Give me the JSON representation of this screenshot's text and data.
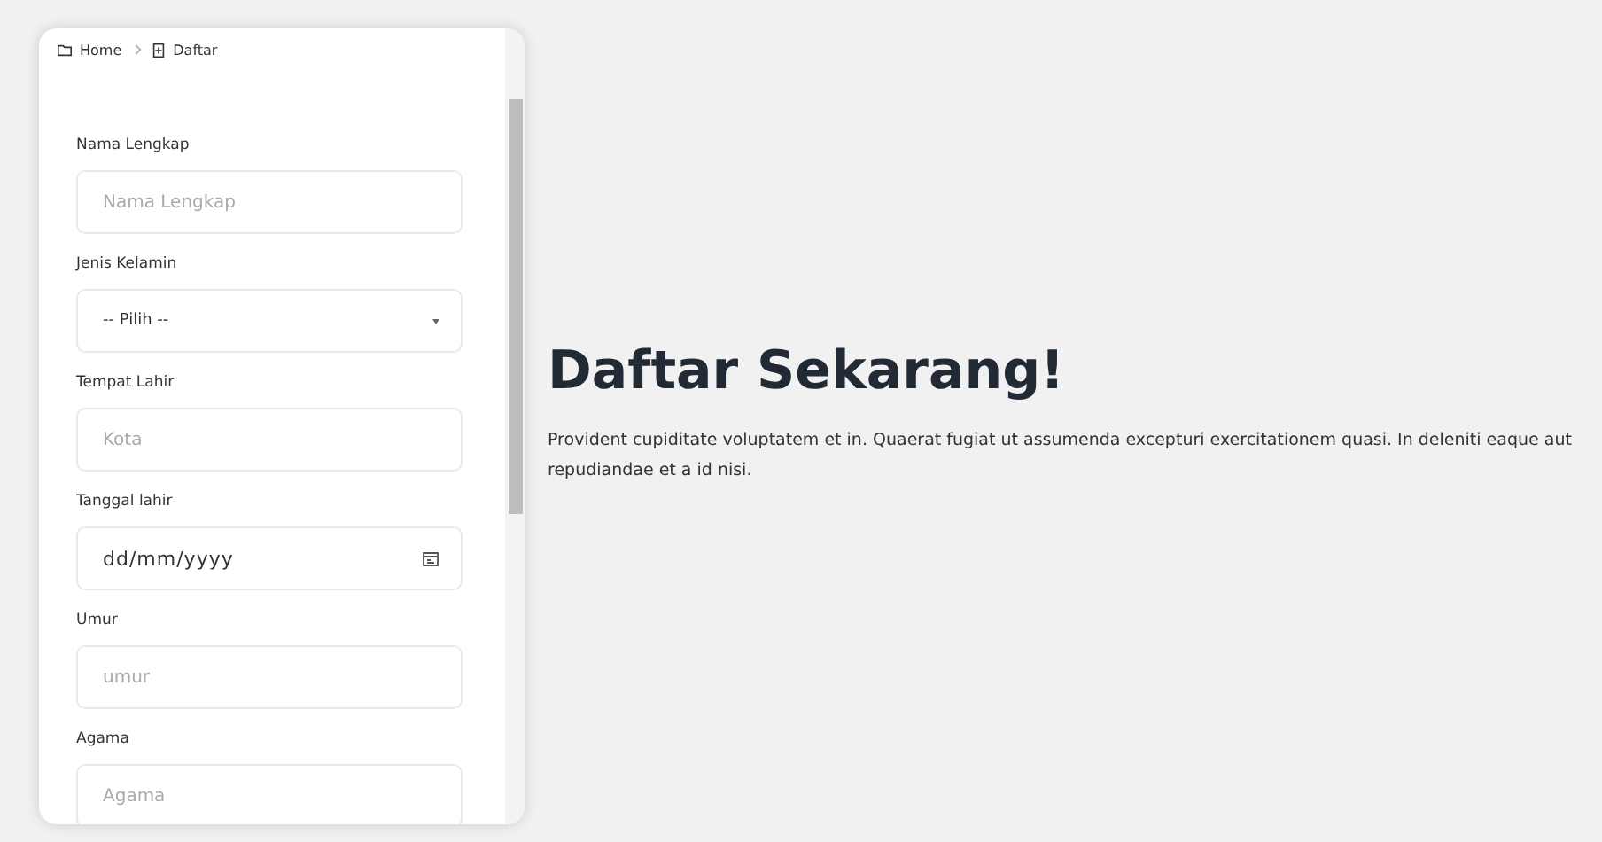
{
  "breadcrumb": [
    {
      "label": "Home",
      "kind": "folder"
    },
    {
      "label": "Daftar",
      "kind": "form"
    }
  ],
  "form": {
    "fields": [
      {
        "label": "Nama Lengkap",
        "kind": "text",
        "placeholder": "Nama Lengkap"
      },
      {
        "label": "Jenis Kelamin",
        "kind": "select",
        "value": "-- Pilih --"
      },
      {
        "label": "Tempat Lahir",
        "kind": "text",
        "placeholder": "Kota"
      },
      {
        "label": "Tanggal lahir",
        "kind": "date",
        "value": "dd/mm/yyyy"
      },
      {
        "label": "Umur",
        "kind": "text",
        "placeholder": "umur"
      },
      {
        "label": "Agama",
        "kind": "text",
        "placeholder": "Agama"
      }
    ]
  },
  "hero": {
    "title": "Daftar Sekarang!",
    "text": "Provident cupiditate voluptatem et in. Quaerat fugiat ut assumenda excepturi exercitationem quasi. In deleniti eaque aut repudiandae et a id nisi."
  }
}
